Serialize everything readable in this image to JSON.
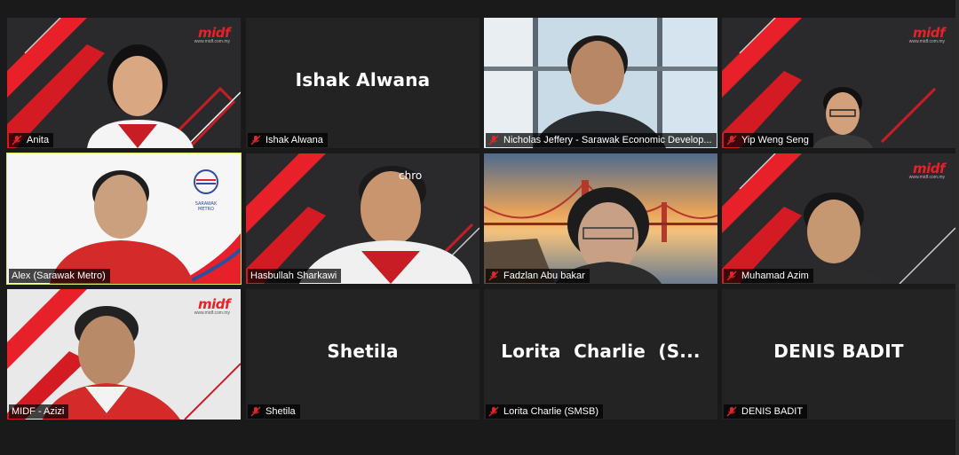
{
  "meeting": {
    "participants": [
      {
        "name": "Anita",
        "has_video": true,
        "muted": true
      },
      {
        "name": "Ishak Alwana",
        "display_name": "Ishak Alwana",
        "has_video": false,
        "muted": true
      },
      {
        "name": "Nicholas Jeffery - Sarawak Economic Develop...",
        "has_video": true,
        "muted": true
      },
      {
        "name": "Yip Weng Seng",
        "has_video": true,
        "muted": true
      },
      {
        "name": "Alex (Sarawak Metro)",
        "has_video": true,
        "muted": false,
        "active_speaker": true,
        "logo_text": "SARAWAK METRO"
      },
      {
        "name": "Hasbullah Sharkawi",
        "has_video": true,
        "muted": false,
        "overlay_text": "chro"
      },
      {
        "name": "Fadzlan Abu bakar",
        "has_video": true,
        "muted": true
      },
      {
        "name": "Muhamad Azim",
        "has_video": true,
        "muted": true
      },
      {
        "name": "MIDF - Azizi",
        "has_video": true,
        "muted": false
      },
      {
        "name": "Shetila",
        "display_name": "Shetila",
        "has_video": false,
        "muted": true
      },
      {
        "name": "Lorita Charlie (SMSB)",
        "display_name": "Lorita  Charlie  (S...",
        "has_video": false,
        "muted": true
      },
      {
        "name": "DENIS BADIT",
        "display_name": "DENIS BADIT",
        "has_video": false,
        "muted": true
      }
    ]
  },
  "branding": {
    "midf_word": "midf",
    "midf_url": "www.midf.com.my",
    "midf_red": "#e8202a",
    "active_border": "#d6e86a"
  },
  "icons": {
    "mute": "mic-muted-icon"
  }
}
